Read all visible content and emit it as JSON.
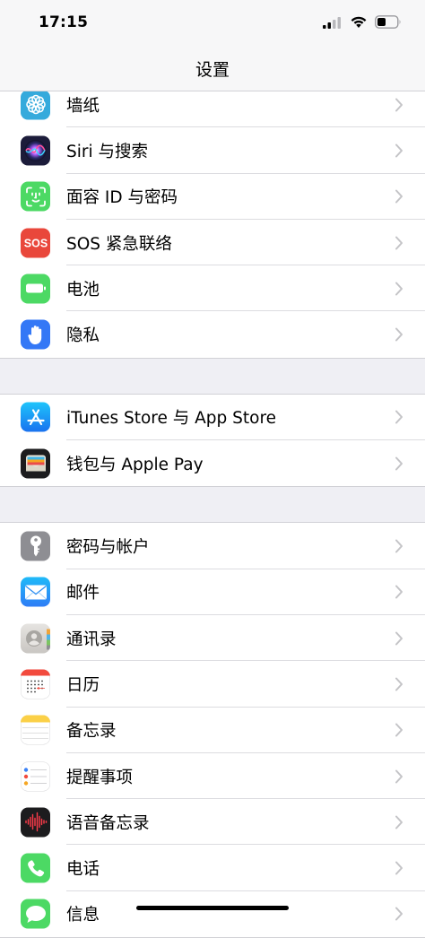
{
  "status": {
    "time": "17:15"
  },
  "nav": {
    "title": "设置"
  },
  "groups": [
    {
      "items": [
        {
          "label": "墙纸",
          "icon": "wallpaper-icon",
          "color": "#35aadc"
        },
        {
          "label": "Siri 与搜索",
          "icon": "siri-icon",
          "color": "#1c1c3a"
        },
        {
          "label": "面容 ID 与密码",
          "icon": "face-id-icon",
          "color": "#4cd964"
        },
        {
          "label": "SOS 紧急联络",
          "icon": "sos-icon",
          "color": "#e9473b"
        },
        {
          "label": "电池",
          "icon": "battery-icon",
          "color": "#4cd964"
        },
        {
          "label": "隐私",
          "icon": "privacy-hand-icon",
          "color": "#3478f6"
        }
      ]
    },
    {
      "items": [
        {
          "label": "iTunes Store 与 App Store",
          "icon": "app-store-icon",
          "color": "#2a8df5"
        },
        {
          "label": "钱包与 Apple Pay",
          "icon": "wallet-icon",
          "color": "#1c1c1e"
        }
      ]
    },
    {
      "items": [
        {
          "label": "密码与帐户",
          "icon": "key-icon",
          "color": "#8e8e93"
        },
        {
          "label": "邮件",
          "icon": "mail-icon",
          "color": "#2f8ff2"
        },
        {
          "label": "通讯录",
          "icon": "contacts-icon",
          "color": "#d8d6d3"
        },
        {
          "label": "日历",
          "icon": "calendar-icon",
          "color": "#ffffff"
        },
        {
          "label": "备忘录",
          "icon": "notes-icon",
          "color": "#ffffff"
        },
        {
          "label": "提醒事项",
          "icon": "reminders-icon",
          "color": "#ffffff"
        },
        {
          "label": "语音备忘录",
          "icon": "voice-memos-icon",
          "color": "#1c1c1e"
        },
        {
          "label": "电话",
          "icon": "phone-icon",
          "color": "#4cd964"
        },
        {
          "label": "信息",
          "icon": "messages-icon",
          "color": "#4cd964"
        }
      ]
    }
  ]
}
